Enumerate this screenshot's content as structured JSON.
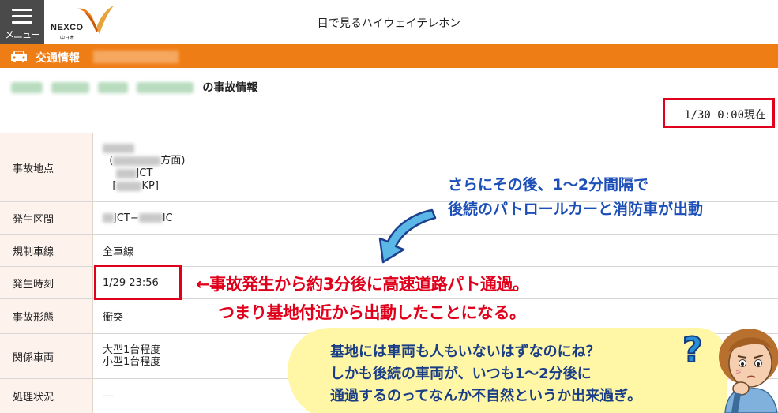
{
  "header": {
    "menu_label": "メニュー",
    "logo_text": "NEXCO",
    "logo_sub": "中日本",
    "site_title": "目で見るハイウェイテレホン"
  },
  "section_bar": {
    "title": "交通情報"
  },
  "page": {
    "heading_suffix": "の事故情報",
    "timestamp": "1/30 0:00現在"
  },
  "table": {
    "rows": [
      {
        "label": "事故地点",
        "value_lines": [
          "(",
          "方面)",
          "JCT",
          "[",
          "KP]"
        ]
      },
      {
        "label": "発生区間",
        "value_a": "JCT−",
        "value_b": "IC"
      },
      {
        "label": "規制車線",
        "value": "全車線"
      },
      {
        "label": "発生時刻",
        "value": "1/29 23:56"
      },
      {
        "label": "事故形態",
        "value": "衝突"
      },
      {
        "label": "関係車両",
        "value_line1": "大型1台程度",
        "value_line2": "小型1台程度"
      },
      {
        "label": "処理状況",
        "value": "---"
      }
    ]
  },
  "annotations": {
    "blue_line1": "さらにその後、1〜2分間隔で",
    "blue_line2": "後続のパトロールカーと消防車が出動",
    "red_line1": "←事故発生から約3分後に高速道路パト通過。",
    "red_line2": "つまり基地付近から出動したことになる。",
    "bubble_line1": "基地には車両も人もいないはずなのにね？",
    "bubble_line2": "しかも後続の車両が、いつも1〜2分後に",
    "bubble_line3": "通過するのってなんか不自然というか出来過ぎ。",
    "question_mark": "?"
  },
  "colors": {
    "orange": "#ef7d16",
    "red": "#e0001b",
    "blue_text": "#1d4fb8",
    "bubble": "#fff6a6",
    "arrow": "#5bb7e6"
  },
  "icons": [
    "menu-icon",
    "car-icon",
    "nexco-logo",
    "curved-arrow-icon",
    "question-mark-icon",
    "thinking-person-illustration"
  ]
}
